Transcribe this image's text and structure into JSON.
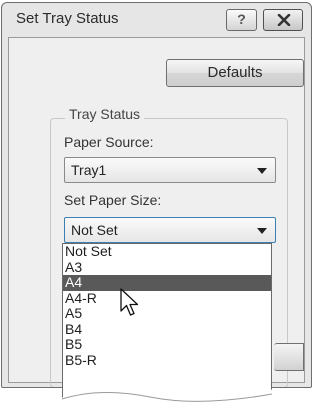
{
  "window": {
    "title": "Set Tray Status",
    "help_label": "?"
  },
  "defaults_button": {
    "label": "Defaults"
  },
  "tray_status": {
    "group_title": "Tray Status",
    "paper_source": {
      "label": "Paper Source:",
      "value": "Tray1"
    },
    "paper_size": {
      "label": "Set Paper Size:",
      "value": "Not Set"
    }
  },
  "paper_size_list": {
    "options": [
      "Not Set",
      "A3",
      "A4",
      "A4-R",
      "A5",
      "B4",
      "B5",
      "B5-R"
    ],
    "highlighted": "A4"
  },
  "icons": {
    "close": "close-icon",
    "help": "help-icon",
    "cursor": "arrow-cursor-icon",
    "dropdown": "chevron-down-icon"
  },
  "colors": {
    "highlight": "#595959",
    "window_bg": "#e6e6e6"
  }
}
